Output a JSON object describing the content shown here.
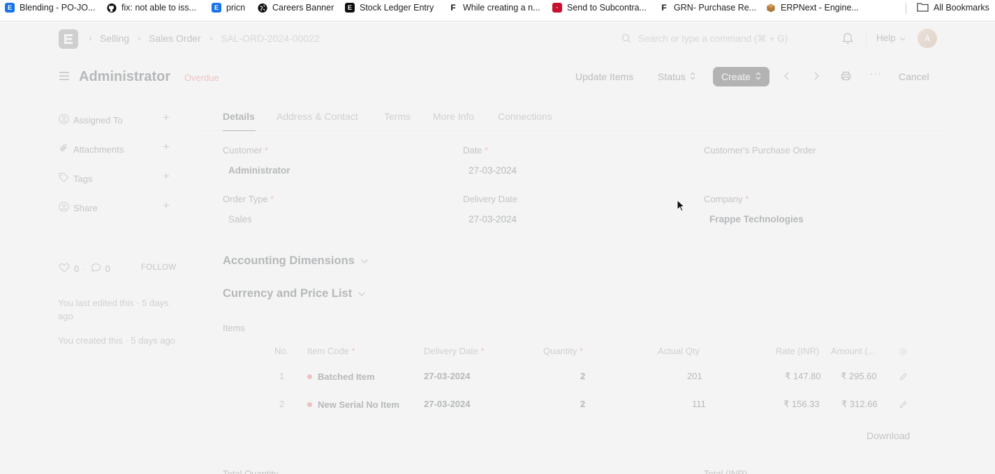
{
  "bookmarks": [
    {
      "label": "Blending - PO-JO...",
      "icon": "erpnext-icon"
    },
    {
      "label": "fix: not able to iss...",
      "icon": "github-icon"
    },
    {
      "label": "pricn",
      "icon": "erpnext-icon"
    },
    {
      "label": "Careers Banner",
      "icon": "globe-icon"
    },
    {
      "label": "Stock Ledger Entry",
      "icon": "erpnext-dark-icon"
    },
    {
      "label": "While creating a n...",
      "icon": "frappe-icon"
    },
    {
      "label": "Send to Subcontra...",
      "icon": "red-site-icon"
    },
    {
      "label": "GRN- Purchase Re...",
      "icon": "frappe-icon"
    },
    {
      "label": "ERPNext - Engine...",
      "icon": "package-icon"
    }
  ],
  "all_bookmarks": "All Bookmarks",
  "navbar": {
    "breadcrumbs": [
      "Selling",
      "Sales Order",
      "SAL-ORD-2024-00022"
    ],
    "search_placeholder": "Search or type a command (⌘ + G)",
    "help": "Help"
  },
  "page": {
    "title": "Administrator",
    "status": "Overdue",
    "buttons": {
      "update_items": "Update Items",
      "status": "Status",
      "create": "Create",
      "cancel": "Cancel"
    }
  },
  "sidebar": {
    "items": [
      "Assigned To",
      "Attachments",
      "Tags",
      "Share"
    ],
    "likes": "0",
    "comments": "0",
    "follow": "FOLLOW",
    "last_edited": "You last edited this · 5 days ago",
    "created": "You created this · 5 days ago"
  },
  "tabs": [
    "Details",
    "Address & Contact",
    "Terms",
    "More Info",
    "Connections"
  ],
  "fields": {
    "customer": {
      "label": "Customer",
      "value": "Administrator"
    },
    "date": {
      "label": "Date",
      "value": "27-03-2024"
    },
    "po": {
      "label": "Customer's Purchase Order"
    },
    "order_type": {
      "label": "Order Type",
      "value": "Sales"
    },
    "delivery_date": {
      "label": "Delivery Date",
      "value": "27-03-2024"
    },
    "company": {
      "label": "Company",
      "value": "Frappe Technologies"
    }
  },
  "sections": {
    "accounting": "Accounting Dimensions",
    "currency": "Currency and Price List",
    "items": "Items"
  },
  "items_table": {
    "headers": [
      "No.",
      "Item Code",
      "Delivery Date",
      "Quantity",
      "Actual Qty",
      "Rate (INR)",
      "Amount (..."
    ],
    "rows": [
      {
        "no": "1",
        "item": "Batched Item",
        "date": "27-03-2024",
        "qty": "2",
        "actual": "201",
        "rate": "₹ 147.80",
        "amount": "₹ 295.60"
      },
      {
        "no": "2",
        "item": "New Serial No Item",
        "date": "27-03-2024",
        "qty": "2",
        "actual": "111",
        "rate": "₹ 156.33",
        "amount": "₹ 312.66"
      }
    ],
    "download": "Download"
  },
  "footer": {
    "total_quantity": "Total Quantity",
    "total_inr": "Total (INR)"
  }
}
